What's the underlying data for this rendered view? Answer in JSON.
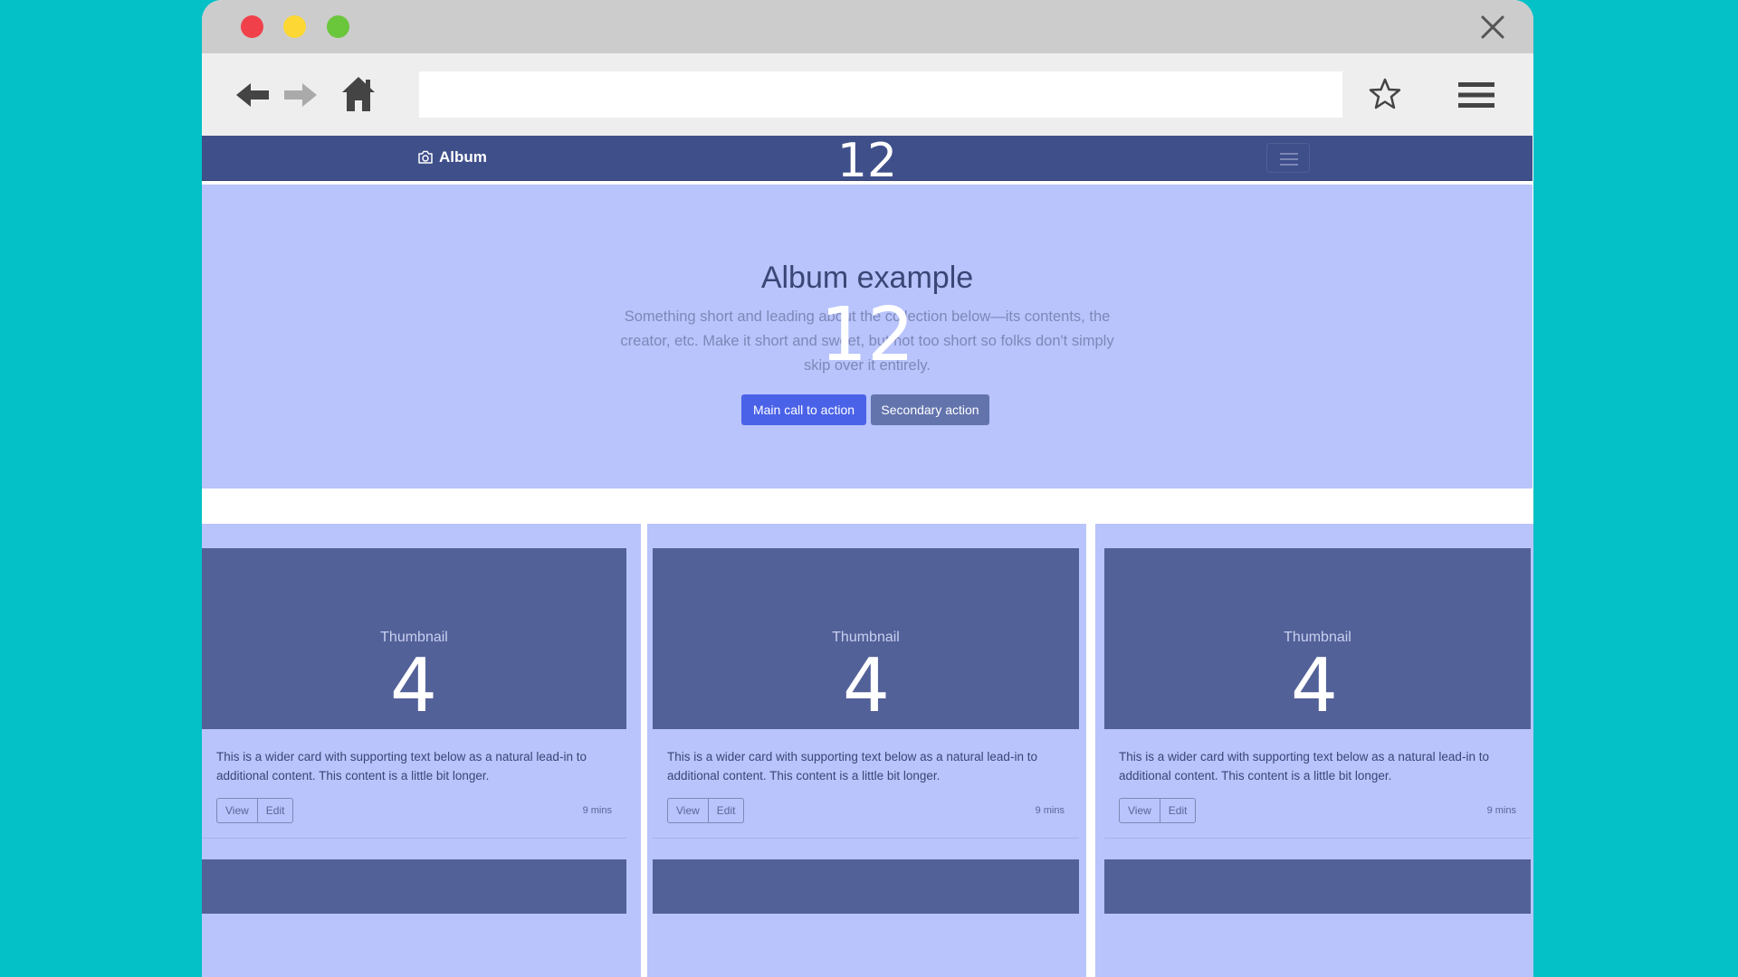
{
  "browser": {
    "url_value": "",
    "url_placeholder": ""
  },
  "site_nav": {
    "brand": "Album",
    "overlay_number": "12"
  },
  "hero": {
    "title": "Album example",
    "lead": "Something short and leading about the collection below—its contents, the creator, etc. Make it short and sweet, but not too short so folks don't simply skip over it entirely.",
    "primary_button": "Main call to action",
    "secondary_button": "Secondary action",
    "overlay_number": "12"
  },
  "cards": [
    {
      "thumb_label": "Thumbnail",
      "overlay_number": "4",
      "text": "This is a wider card with supporting text below as a natural lead-in to additional content. This content is a little bit longer.",
      "view_label": "View",
      "edit_label": "Edit",
      "time": "9 mins"
    },
    {
      "thumb_label": "Thumbnail",
      "overlay_number": "4",
      "text": "This is a wider card with supporting text below as a natural lead-in to additional content. This content is a little bit longer.",
      "view_label": "View",
      "edit_label": "Edit",
      "time": "9 mins"
    },
    {
      "thumb_label": "Thumbnail",
      "overlay_number": "4",
      "text": "This is a wider card with supporting text below as a natural lead-in to additional content. This content is a little bit longer.",
      "view_label": "View",
      "edit_label": "Edit",
      "time": "9 mins"
    }
  ],
  "colors": {
    "page_background": "#04c0c7",
    "navbar": "#3f4f8a",
    "jumbotron": "#b8c4fb",
    "card_image": "#536199",
    "primary": "#4a62e8",
    "secondary": "#6374ad"
  }
}
